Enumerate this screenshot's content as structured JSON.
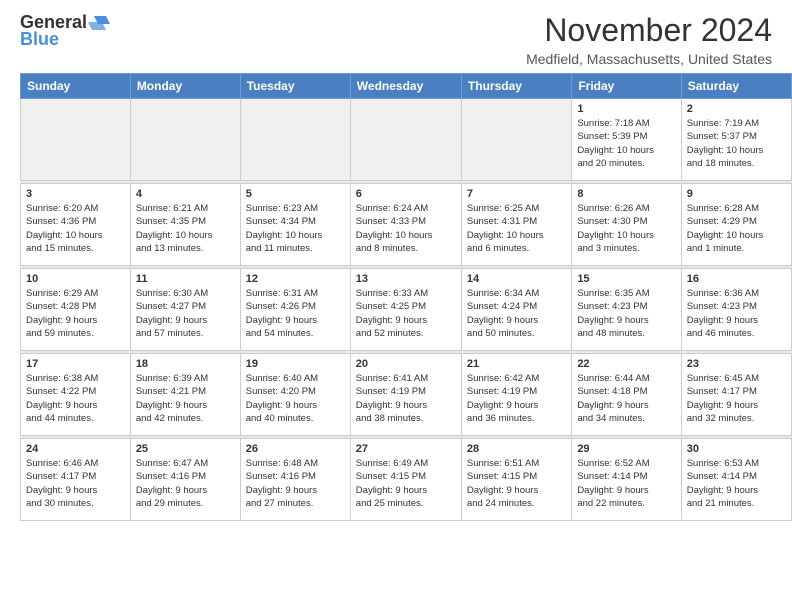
{
  "header": {
    "logo_general": "General",
    "logo_blue": "Blue",
    "month_title": "November 2024",
    "location": "Medfield, Massachusetts, United States"
  },
  "calendar": {
    "days_of_week": [
      "Sunday",
      "Monday",
      "Tuesday",
      "Wednesday",
      "Thursday",
      "Friday",
      "Saturday"
    ],
    "weeks": [
      [
        {
          "day": "",
          "info": ""
        },
        {
          "day": "",
          "info": ""
        },
        {
          "day": "",
          "info": ""
        },
        {
          "day": "",
          "info": ""
        },
        {
          "day": "",
          "info": ""
        },
        {
          "day": "1",
          "info": "Sunrise: 7:18 AM\nSunset: 5:39 PM\nDaylight: 10 hours\nand 20 minutes."
        },
        {
          "day": "2",
          "info": "Sunrise: 7:19 AM\nSunset: 5:37 PM\nDaylight: 10 hours\nand 18 minutes."
        }
      ],
      [
        {
          "day": "3",
          "info": "Sunrise: 6:20 AM\nSunset: 4:36 PM\nDaylight: 10 hours\nand 15 minutes."
        },
        {
          "day": "4",
          "info": "Sunrise: 6:21 AM\nSunset: 4:35 PM\nDaylight: 10 hours\nand 13 minutes."
        },
        {
          "day": "5",
          "info": "Sunrise: 6:23 AM\nSunset: 4:34 PM\nDaylight: 10 hours\nand 11 minutes."
        },
        {
          "day": "6",
          "info": "Sunrise: 6:24 AM\nSunset: 4:33 PM\nDaylight: 10 hours\nand 8 minutes."
        },
        {
          "day": "7",
          "info": "Sunrise: 6:25 AM\nSunset: 4:31 PM\nDaylight: 10 hours\nand 6 minutes."
        },
        {
          "day": "8",
          "info": "Sunrise: 6:26 AM\nSunset: 4:30 PM\nDaylight: 10 hours\nand 3 minutes."
        },
        {
          "day": "9",
          "info": "Sunrise: 6:28 AM\nSunset: 4:29 PM\nDaylight: 10 hours\nand 1 minute."
        }
      ],
      [
        {
          "day": "10",
          "info": "Sunrise: 6:29 AM\nSunset: 4:28 PM\nDaylight: 9 hours\nand 59 minutes."
        },
        {
          "day": "11",
          "info": "Sunrise: 6:30 AM\nSunset: 4:27 PM\nDaylight: 9 hours\nand 57 minutes."
        },
        {
          "day": "12",
          "info": "Sunrise: 6:31 AM\nSunset: 4:26 PM\nDaylight: 9 hours\nand 54 minutes."
        },
        {
          "day": "13",
          "info": "Sunrise: 6:33 AM\nSunset: 4:25 PM\nDaylight: 9 hours\nand 52 minutes."
        },
        {
          "day": "14",
          "info": "Sunrise: 6:34 AM\nSunset: 4:24 PM\nDaylight: 9 hours\nand 50 minutes."
        },
        {
          "day": "15",
          "info": "Sunrise: 6:35 AM\nSunset: 4:23 PM\nDaylight: 9 hours\nand 48 minutes."
        },
        {
          "day": "16",
          "info": "Sunrise: 6:36 AM\nSunset: 4:23 PM\nDaylight: 9 hours\nand 46 minutes."
        }
      ],
      [
        {
          "day": "17",
          "info": "Sunrise: 6:38 AM\nSunset: 4:22 PM\nDaylight: 9 hours\nand 44 minutes."
        },
        {
          "day": "18",
          "info": "Sunrise: 6:39 AM\nSunset: 4:21 PM\nDaylight: 9 hours\nand 42 minutes."
        },
        {
          "day": "19",
          "info": "Sunrise: 6:40 AM\nSunset: 4:20 PM\nDaylight: 9 hours\nand 40 minutes."
        },
        {
          "day": "20",
          "info": "Sunrise: 6:41 AM\nSunset: 4:19 PM\nDaylight: 9 hours\nand 38 minutes."
        },
        {
          "day": "21",
          "info": "Sunrise: 6:42 AM\nSunset: 4:19 PM\nDaylight: 9 hours\nand 36 minutes."
        },
        {
          "day": "22",
          "info": "Sunrise: 6:44 AM\nSunset: 4:18 PM\nDaylight: 9 hours\nand 34 minutes."
        },
        {
          "day": "23",
          "info": "Sunrise: 6:45 AM\nSunset: 4:17 PM\nDaylight: 9 hours\nand 32 minutes."
        }
      ],
      [
        {
          "day": "24",
          "info": "Sunrise: 6:46 AM\nSunset: 4:17 PM\nDaylight: 9 hours\nand 30 minutes."
        },
        {
          "day": "25",
          "info": "Sunrise: 6:47 AM\nSunset: 4:16 PM\nDaylight: 9 hours\nand 29 minutes."
        },
        {
          "day": "26",
          "info": "Sunrise: 6:48 AM\nSunset: 4:16 PM\nDaylight: 9 hours\nand 27 minutes."
        },
        {
          "day": "27",
          "info": "Sunrise: 6:49 AM\nSunset: 4:15 PM\nDaylight: 9 hours\nand 25 minutes."
        },
        {
          "day": "28",
          "info": "Sunrise: 6:51 AM\nSunset: 4:15 PM\nDaylight: 9 hours\nand 24 minutes."
        },
        {
          "day": "29",
          "info": "Sunrise: 6:52 AM\nSunset: 4:14 PM\nDaylight: 9 hours\nand 22 minutes."
        },
        {
          "day": "30",
          "info": "Sunrise: 6:53 AM\nSunset: 4:14 PM\nDaylight: 9 hours\nand 21 minutes."
        }
      ]
    ]
  }
}
